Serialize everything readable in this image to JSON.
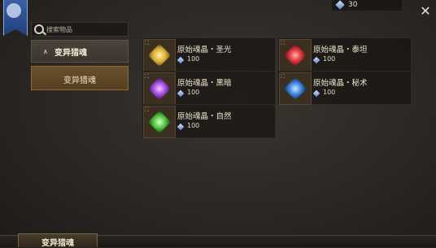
{
  "currency": {
    "icon": "soul-crystal-icon",
    "value": "30"
  },
  "search": {
    "placeholder": "搜索物品"
  },
  "category": {
    "header": "变异猎魂",
    "selected": "变异猎魂"
  },
  "items": [
    {
      "name": "原始魂晶・圣光",
      "count": "100",
      "icon": "holy-soul-crystal-icon",
      "color": "#d9b23a"
    },
    {
      "name": "原始魂晶・泰坦",
      "count": "100",
      "icon": "titan-soul-crystal-icon",
      "color": "#d8303a"
    },
    {
      "name": "原始魂晶・黑暗",
      "count": "100",
      "icon": "dark-soul-crystal-icon",
      "color": "#a04ad8"
    },
    {
      "name": "原始魂晶・秘术",
      "count": "100",
      "icon": "arcane-soul-crystal-icon",
      "color": "#3a7fd8"
    },
    {
      "name": "原始魂晶・自然",
      "count": "100",
      "icon": "nature-soul-crystal-icon",
      "color": "#4ec23a"
    }
  ],
  "bottom_tab": {
    "label": "变异猎魂"
  }
}
